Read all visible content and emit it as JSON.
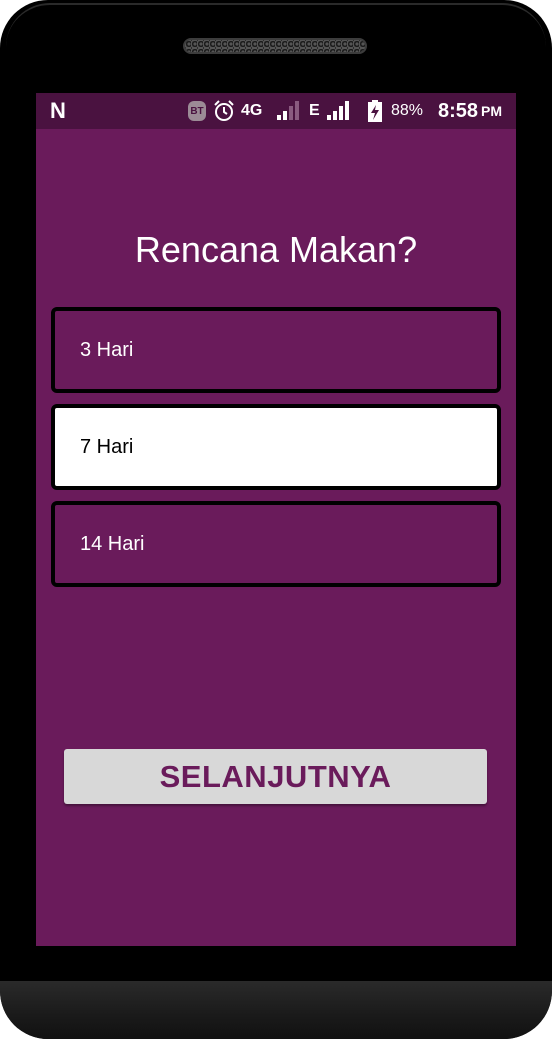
{
  "status_bar": {
    "left_icon": "n-logo-icon",
    "left_glyph": "N",
    "bt_label": "BT",
    "network_1": "4G",
    "network_2": "E",
    "battery_percent": "88%",
    "time": "8:58",
    "time_suffix": "PM"
  },
  "screen": {
    "title": "Rencana Makan?",
    "options": [
      {
        "label": "3 Hari",
        "selected": false
      },
      {
        "label": "7 Hari",
        "selected": true
      },
      {
        "label": "14 Hari",
        "selected": false
      }
    ],
    "next_button_label": "SELANJUTNYA"
  },
  "colors": {
    "background": "#6a1b5b",
    "status_bar": "#4a1240",
    "selected_option": "#ffffff",
    "button": "#d8d8d8",
    "button_text": "#6a1b5b"
  }
}
